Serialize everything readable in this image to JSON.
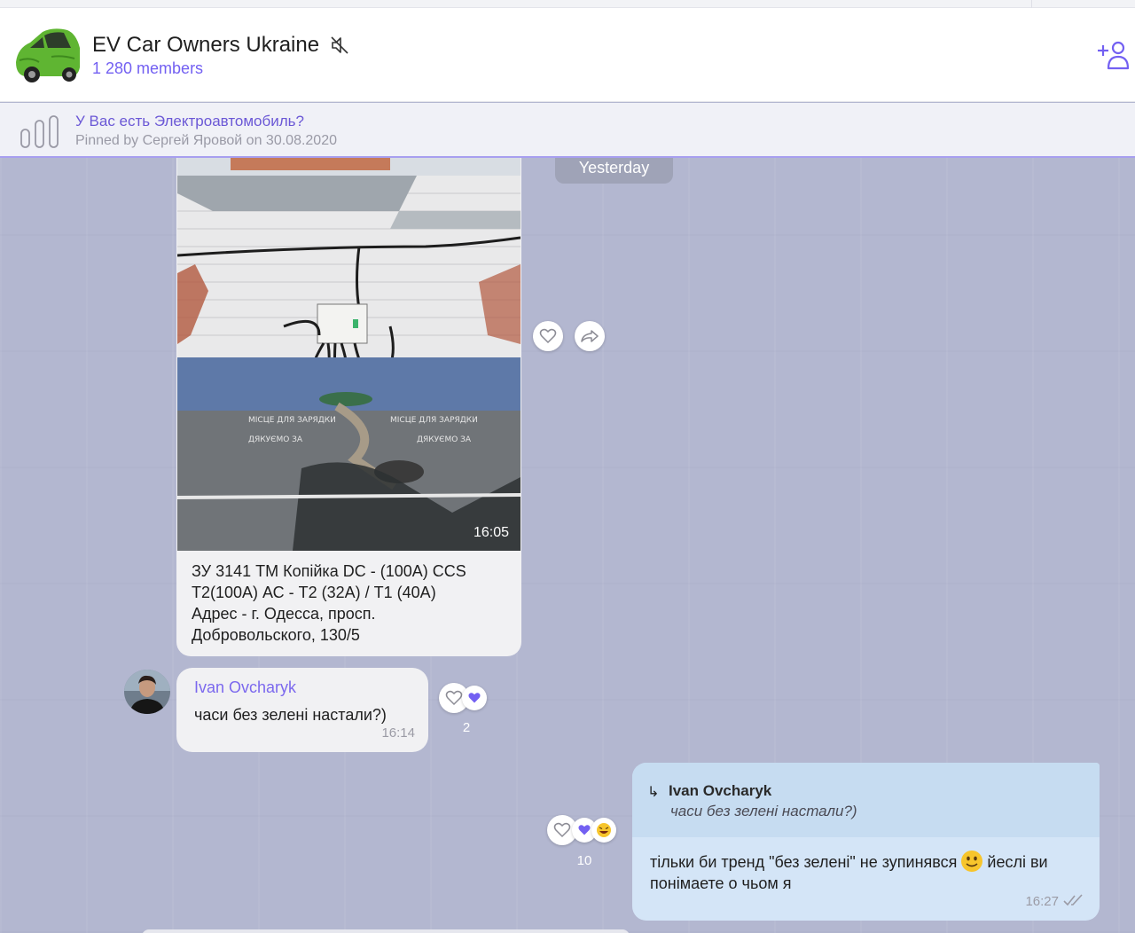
{
  "header": {
    "group_name": "EV Car Owners Ukraine",
    "members": "1 280 members",
    "mute_icon": "muted-speaker-icon",
    "add_icon": "add-member-icon"
  },
  "pinned": {
    "title": "У Вас есть Электроавтомобиль?",
    "subtitle": "Pinned by Сергей Яровой on 30.08.2020",
    "icon": "poll-icon"
  },
  "chat": {
    "date_separator": "Yesterday",
    "messages": [
      {
        "type": "image",
        "time": "16:05",
        "caption": "ЗУ 3141 ТМ Копійка  DC - (100А) CCS\nТ2(100А) АС - Т2 (32А) / Т1 (40А)\nАдрес - г. Одесса, просп.\nДобровольского, 130/5"
      },
      {
        "type": "text",
        "author": "Ivan Ovcharyk",
        "text": "часи без зелені настали?)",
        "time": "16:14",
        "reaction_count": "2"
      },
      {
        "type": "reply",
        "reply_author": "Ivan Ovcharyk",
        "reply_text": "часи без зелені настали?)",
        "text_before": "тільки би тренд \"без зелені\" не зупинявся",
        "text_after": "йеслі ви понімаете о чьом я",
        "time": "16:27",
        "reaction_count": "10"
      }
    ]
  },
  "colors": {
    "accent": "#7360f2",
    "chat_bg": "#b3b7d0",
    "incoming_bubble": "#f1f1f3",
    "outgoing_bubble": "#d4e5f7",
    "reply_box": "#c6dcf1"
  }
}
